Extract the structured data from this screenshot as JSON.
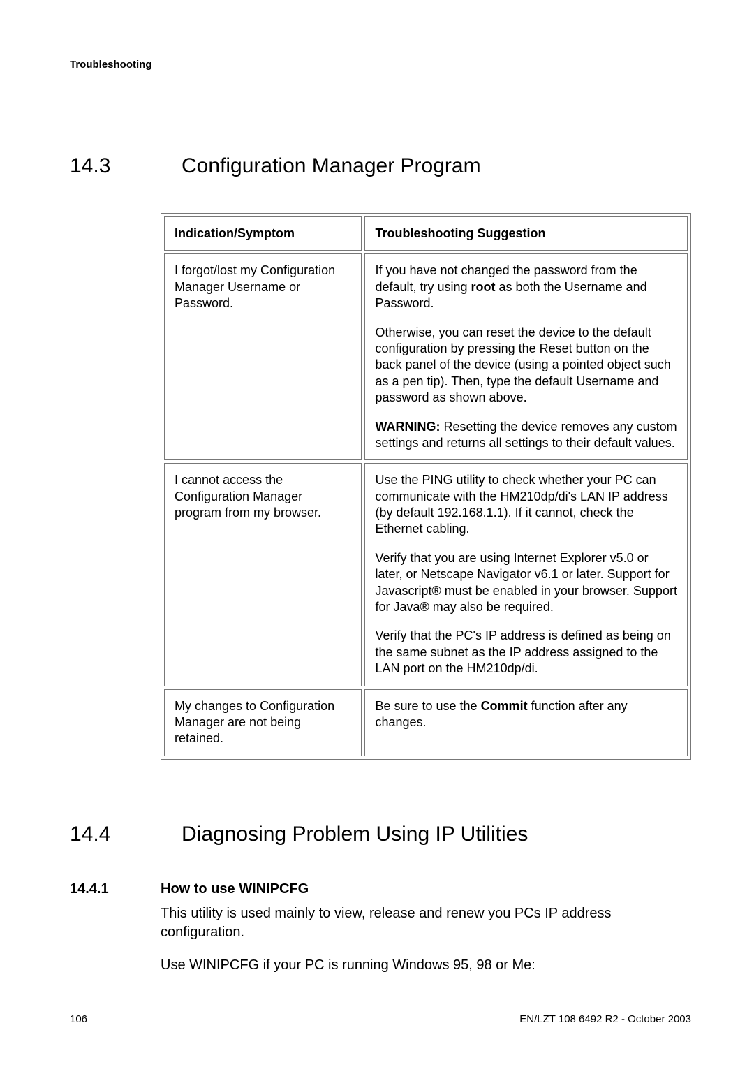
{
  "header": {
    "running": "Troubleshooting"
  },
  "section1": {
    "number": "14.3",
    "title": "Configuration Manager Program",
    "table": {
      "headers": [
        "Indication/Symptom",
        "Troubleshooting Suggestion"
      ],
      "rows": [
        {
          "symptom": "I forgot/lost my Configuration Manager Username or Password.",
          "suggestion": {
            "p1_before": "If you have not changed the password from the default, try using ",
            "p1_bold": "root",
            "p1_after": " as both the Username and Password.",
            "p2": "Otherwise, you can reset the device to the default configuration by pressing the Reset button on the back panel of the device (using a pointed object such as a pen tip). Then, type the default Username and password as shown above.",
            "p3_bold": "WARNING:",
            "p3_rest": " Resetting the device removes any custom settings and returns all settings to their default values."
          }
        },
        {
          "symptom": "I cannot access the Configuration Manager program from my browser.",
          "suggestion": {
            "p1": "Use the PING utility to check whether your PC can communicate with the HM210dp/di's LAN IP address (by default 192.168.1.1). If it cannot, check the Ethernet cabling.",
            "p2": "Verify that you are using Internet Explorer v5.0 or later, or Netscape Navigator v6.1 or later. Support for Javascript® must be enabled in your browser. Support for Java® may also be required.",
            "p3": "Verify that the PC's IP address is defined as being on the same subnet as the IP address assigned to the LAN port on the HM210dp/di."
          }
        },
        {
          "symptom": "My changes to Configuration Manager are not being retained.",
          "suggestion": {
            "p1_before": "Be sure to use the ",
            "p1_bold": "Commit",
            "p1_after": " function after any changes."
          }
        }
      ]
    }
  },
  "section2": {
    "number": "14.4",
    "title": "Diagnosing Problem Using IP Utilities",
    "sub": {
      "number": "14.4.1",
      "title": "How to use WINIPCFG",
      "p1": "This utility is used mainly to view, release and renew you PCs IP address configuration.",
      "p2": "Use WINIPCFG if your PC is running Windows 95, 98 or Me:"
    }
  },
  "footer": {
    "page": "106",
    "doc": "EN/LZT 108 6492 R2  -  October 2003"
  }
}
